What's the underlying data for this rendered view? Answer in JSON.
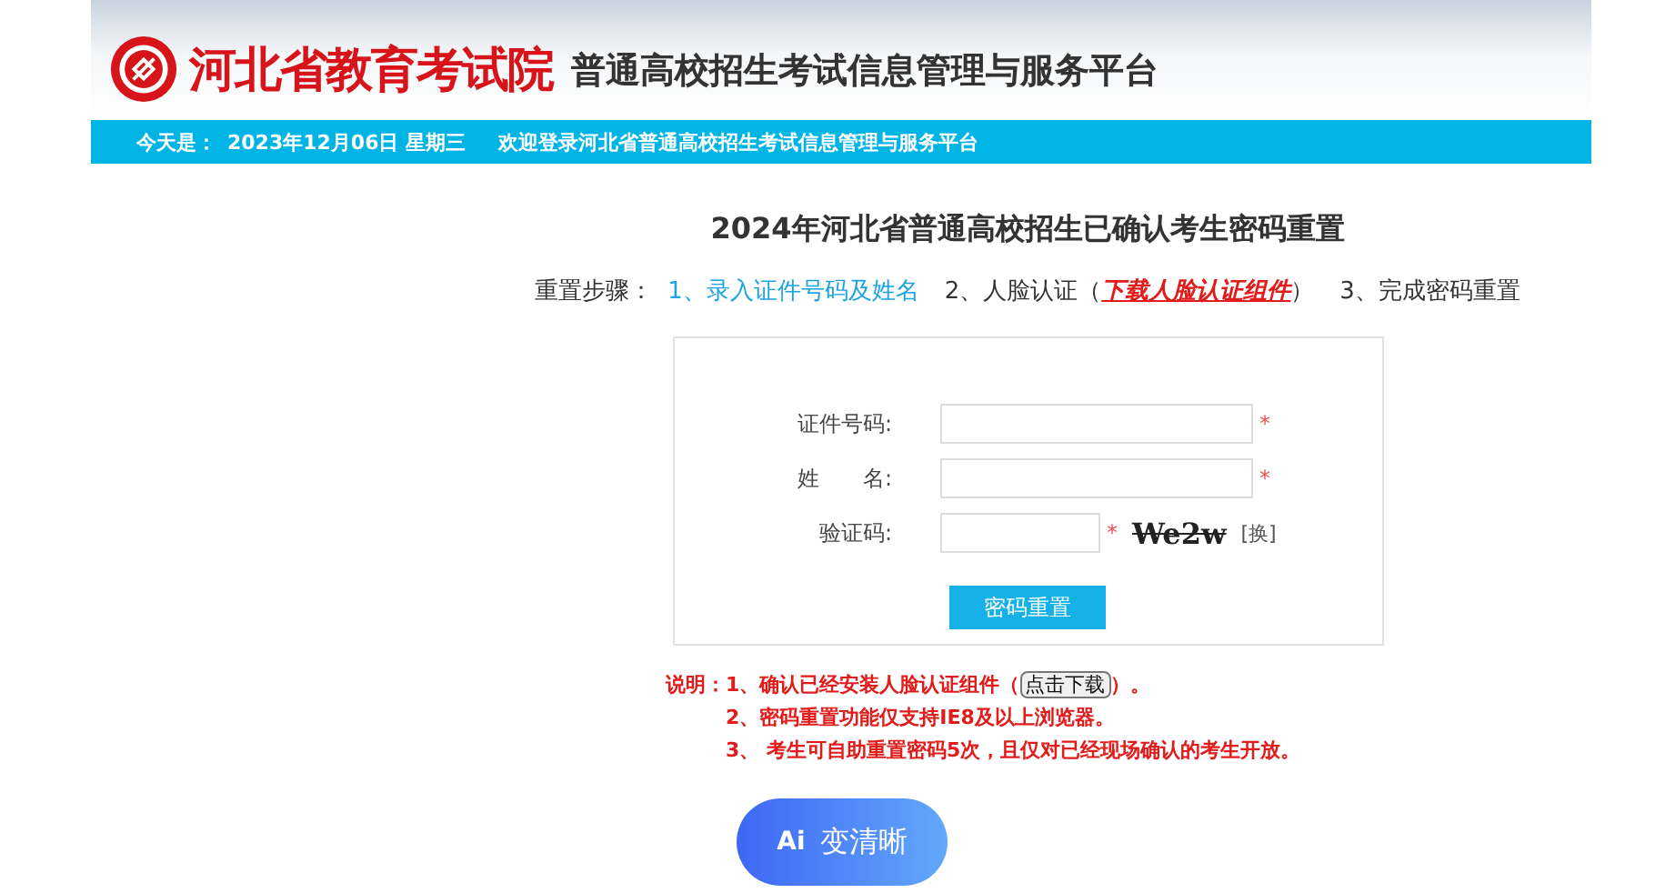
{
  "header": {
    "org_name": "河北省教育考试院",
    "platform_name": "普通高校招生考试信息管理与服务平台"
  },
  "info_bar": {
    "date_label": "今天是：",
    "date": "2023年12月06日 星期三",
    "welcome": "欢迎登录河北省普通高校招生考试信息管理与服务平台"
  },
  "page_title": "2024年河北省普通高校招生已确认考生密码重置",
  "steps": {
    "label": "重置步骤：",
    "items": [
      {
        "text": "1、录入证件号码及姓名",
        "selected": true
      },
      {
        "text": "2、人脸认证（",
        "link": "下载人脸认证组件",
        "suffix": "）",
        "selected": false
      },
      {
        "text": "3、完成密码重置",
        "selected": false
      }
    ]
  },
  "form": {
    "fields": [
      {
        "kind": "text",
        "label": "证件号码:",
        "required_mark": "*"
      },
      {
        "kind": "text",
        "label": "姓　　名:",
        "required_mark": "*"
      },
      {
        "kind": "captcha",
        "label": "验证码:",
        "required_mark": "*",
        "captcha": "We2w",
        "refresh": "[换]"
      }
    ],
    "submit": "密码重置"
  },
  "notes": {
    "label": "说明：",
    "items": [
      {
        "text": "1、确认已经安装人脸认证组件（",
        "button": "点击下载",
        "suffix": "）。"
      },
      {
        "text": "2、密码重置功能仅支持IE8及以上浏览器。"
      },
      {
        "text": "3、 考生可自助重置密码5次，且仅对已经现场确认的考生开放。"
      }
    ]
  },
  "ai_button": {
    "icon_text": "Ai",
    "label": "变清晰"
  }
}
